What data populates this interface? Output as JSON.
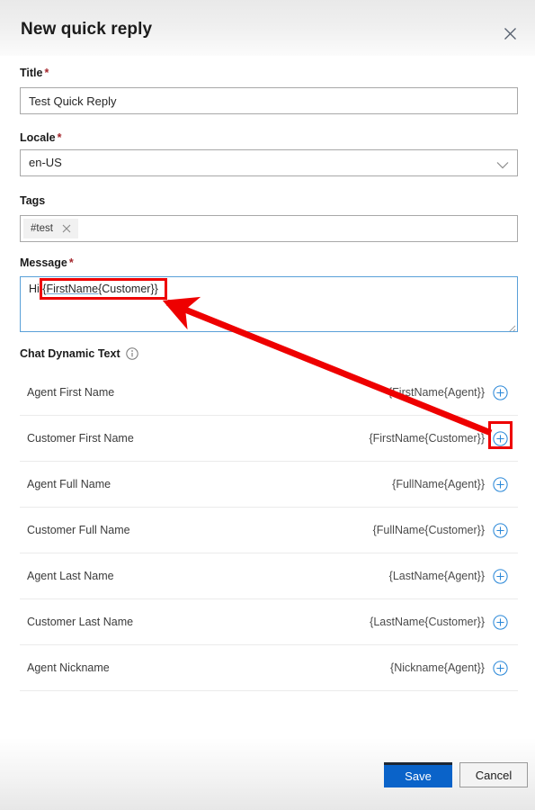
{
  "dialog": {
    "title": "New quick reply",
    "close_icon": "close-icon"
  },
  "form": {
    "title_field": {
      "label": "Title",
      "required_marker": "*",
      "value": "Test Quick Reply",
      "placeholder": ""
    },
    "locale_field": {
      "label": "Locale",
      "required_marker": "*",
      "value": "en-US",
      "chevron_icon": "chevron-down-icon"
    },
    "tags_field": {
      "label": "Tags",
      "chips": [
        {
          "text": "#test",
          "remove_icon": "close-icon"
        }
      ]
    },
    "message_field": {
      "label": "Message",
      "required_marker": "*",
      "value_prefix": "Hi ",
      "value_token": "{FirstName{",
      "value_suffix": "Customer}}",
      "full_value": "Hi {FirstName{Customer}}"
    }
  },
  "dynamic_text": {
    "heading": "Chat Dynamic Text",
    "info_icon": "info-icon",
    "add_icon": "plus-circle-icon",
    "rows": [
      {
        "name": "Agent First Name",
        "token": "{FirstName{Agent}}"
      },
      {
        "name": "Customer First Name",
        "token": "{FirstName{Customer}}"
      },
      {
        "name": "Agent Full Name",
        "token": "{FullName{Agent}}"
      },
      {
        "name": "Customer Full Name",
        "token": "{FullName{Customer}}"
      },
      {
        "name": "Agent Last Name",
        "token": "{LastName{Agent}}"
      },
      {
        "name": "Customer Last Name",
        "token": "{LastName{Customer}}"
      },
      {
        "name": "Agent Nickname",
        "token": "{Nickname{Agent}}"
      }
    ]
  },
  "footer": {
    "save_label": "Save",
    "cancel_label": "Cancel"
  },
  "annotations": {
    "highlight_color": "#ee0000",
    "arrow_from": "plus-circle-icon of Customer First Name row",
    "arrow_to": "message textarea token text"
  },
  "colors": {
    "primary_button": "#0a63c9",
    "required_asterisk": "#a4262c",
    "focus_border": "#5aa0d8",
    "add_icon": "#2b88d8",
    "annotation": "#ee0000"
  }
}
